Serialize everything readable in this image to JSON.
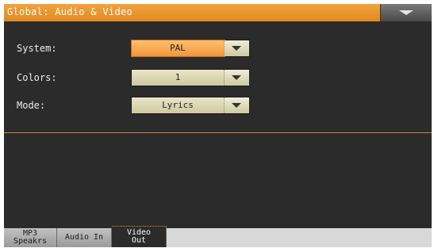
{
  "header": {
    "title": "Global: Audio & Video"
  },
  "settings": [
    {
      "label": "System:",
      "value": "PAL"
    },
    {
      "label": "Colors:",
      "value": "1"
    },
    {
      "label": "Mode:",
      "value": "Lyrics"
    }
  ],
  "tabs": [
    {
      "label": "MP3\nSpeakrs"
    },
    {
      "label": "Audio In"
    },
    {
      "label": "Video\nOut"
    }
  ],
  "colors": {
    "title_bar": "#e08a1f",
    "active_field": "#f0963a",
    "field": "#cfc9a0",
    "background": "#2b2b2b"
  }
}
